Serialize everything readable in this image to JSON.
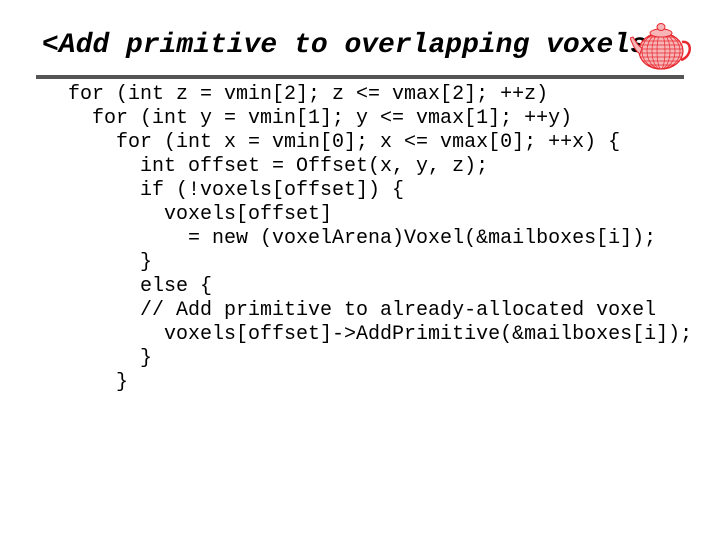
{
  "slide": {
    "title": "<Add primitive to overlapping voxels>",
    "logo_icon": "teapot-wireframe-icon",
    "accent_color": "#e8262d",
    "rule_color": "#555555"
  },
  "code": {
    "language": "C++",
    "lines": [
      {
        "indent": 0,
        "text": "for (int z = vmin[2]; z <= vmax[2]; ++z)"
      },
      {
        "indent": 1,
        "text": "for (int y = vmin[1]; y <= vmax[1]; ++y)"
      },
      {
        "indent": 2,
        "text": "for (int x = vmin[0]; x <= vmax[0]; ++x) {"
      },
      {
        "indent": 3,
        "text": "int offset = Offset(x, y, z);"
      },
      {
        "indent": 3,
        "text": "if (!voxels[offset]) {"
      },
      {
        "indent": 4,
        "text": "voxels[offset]"
      },
      {
        "indent": 5,
        "text": "= new (voxelArena)Voxel(&mailboxes[i]);"
      },
      {
        "indent": 3,
        "text": "}"
      },
      {
        "indent": 3,
        "text": "else {"
      },
      {
        "indent": 3,
        "text": "// Add primitive to already-allocated voxel"
      },
      {
        "indent": 4,
        "text": "voxels[offset]->AddPrimitive(&mailboxes[i]);"
      },
      {
        "indent": 3,
        "text": "}"
      },
      {
        "indent": 2,
        "text": "}"
      }
    ]
  }
}
